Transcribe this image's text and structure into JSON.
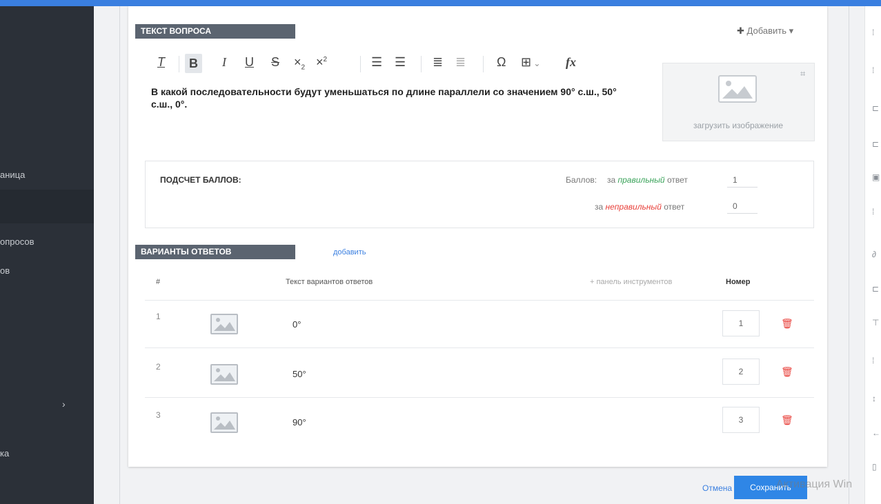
{
  "sidebar": {
    "items": [
      {
        "label": "аница"
      },
      {
        "label": "опросов"
      },
      {
        "label": "ов"
      },
      {
        "label": "ка"
      }
    ],
    "chevron": "›"
  },
  "question_section": {
    "header": "ТЕКСТ ВОПРОСА",
    "add_label": "Добавить",
    "toolbar": [
      "clear-format",
      "bold",
      "italic",
      "underline",
      "strikethrough",
      "subscript",
      "superscript",
      "ordered-list",
      "bullet-list",
      "indent",
      "outdent",
      "special-char",
      "table",
      "formula"
    ],
    "question_text": "В какой последовательности будут  уменьшаться по длине параллели со значением 90° с.ш., 50° с.ш., 0°.",
    "upload_label": "загрузить изображение"
  },
  "scoring": {
    "title": "ПОДСЧЕТ БАЛЛОВ:",
    "points_label": "Баллов:",
    "correct_prefix": "за",
    "correct_word": "правильный",
    "correct_suffix": "ответ",
    "correct_value": "1",
    "wrong_prefix": "за",
    "wrong_word": "неправильный",
    "wrong_suffix": "ответ",
    "wrong_value": "0",
    "correct_color": "#3aa35a",
    "wrong_color": "#e8403a"
  },
  "answers": {
    "header": "ВАРИАНТЫ ОТВЕТОВ",
    "add_label": "добавить",
    "columns": {
      "num": "#",
      "text": "Текст вариантов ответов",
      "toolbar": "+ панель инструментов",
      "number": "Номер"
    },
    "rows": [
      {
        "num": "1",
        "text": "0°",
        "order": "1"
      },
      {
        "num": "2",
        "text": "50°",
        "order": "2"
      },
      {
        "num": "3",
        "text": "90°",
        "order": "3"
      }
    ]
  },
  "footer": {
    "cancel_label": "Отмена",
    "save_label": "Сохранить"
  },
  "watermark": "Активация Win",
  "colors": {
    "accent": "#3a7fe0",
    "sidebar_bg": "#2b3038",
    "header_tab": "#5b6470",
    "delete": "#e8403a"
  }
}
